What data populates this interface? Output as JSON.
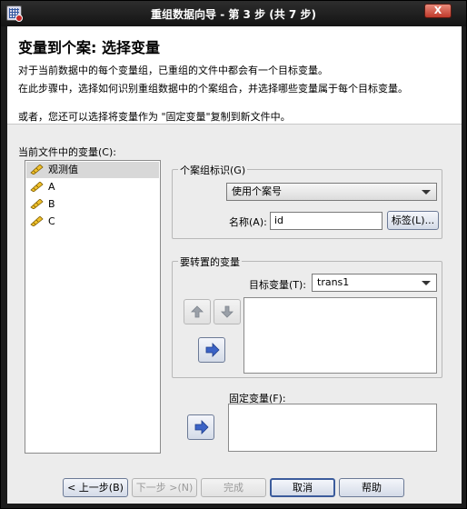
{
  "window": {
    "title": "重组数据向导 - 第 3 步 (共 7 步)",
    "close_label": "X"
  },
  "header": {
    "heading": "变量到个案: 选择变量",
    "line1": "对于当前数据中的每个变量组，已重组的文件中都会有一个目标变量。",
    "line2": "在此步骤中，选择如何识别重组数据中的个案组合，并选择哪些变量属于每个目标变量。"
  },
  "note": "或者，您还可以选择将变量作为 \"固定变量\"复制到新文件中。",
  "current_vars": {
    "label": "当前文件中的变量(C):",
    "items": [
      {
        "label": "观测值",
        "selected": true
      },
      {
        "label": "A",
        "selected": false
      },
      {
        "label": "B",
        "selected": false
      },
      {
        "label": "C",
        "selected": false
      }
    ]
  },
  "case_group": {
    "label": "个案组标识(G)",
    "method": "使用个案号",
    "name_label": "名称(A):",
    "name_value": "id",
    "label_button": "标签(L)..."
  },
  "transpose": {
    "label": "要转置的变量",
    "target_label": "目标变量(T):",
    "target_value": "trans1"
  },
  "fixed": {
    "label": "固定变量(F):"
  },
  "buttons": {
    "back": "< 上一步(B)",
    "next": "下一步 >(N)",
    "finish": "完成",
    "cancel": "取消",
    "help": "帮助"
  },
  "colors": {
    "arrow_blue": "#3b63c6",
    "accent_border": "#3c5c9c"
  }
}
